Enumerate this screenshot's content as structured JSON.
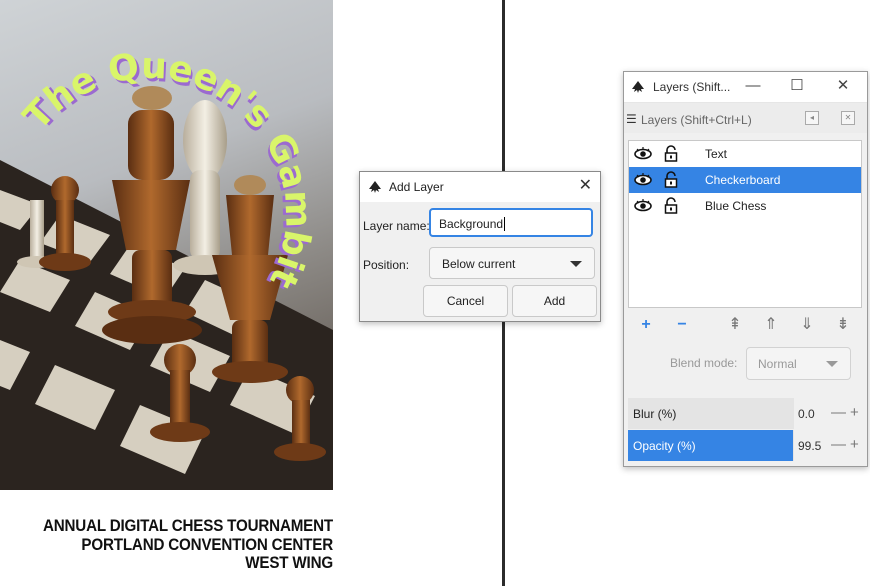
{
  "poster": {
    "title_arc": "The Queen's Gambit",
    "caption_lines": [
      "ANNUAL DIGITAL CHESS TOURNAMENT",
      "PORTLAND CONVENTION CENTER",
      "WEST WING"
    ],
    "title_color": "#d9f56a",
    "title_shadow": "#9b6ad0"
  },
  "add_layer_dialog": {
    "title": "Add Layer",
    "close_glyph": "✕",
    "layer_name_label": "Layer name:",
    "layer_name_value": "Background",
    "position_label": "Position:",
    "position_value": "Below current",
    "cancel_label": "Cancel",
    "add_label": "Add"
  },
  "layers_panel": {
    "window_title": "Layers (Shift...",
    "minimize_glyph": "—",
    "maximize_glyph": "☐",
    "close_glyph": "✕",
    "tab_label": "Layers (Shift+Ctrl+L)",
    "layers": [
      {
        "name": "Text",
        "selected": false
      },
      {
        "name": "Checkerboard",
        "selected": true
      },
      {
        "name": "Blue Chess",
        "selected": false
      }
    ],
    "tools": {
      "add": "+",
      "remove": "−",
      "raise_to_top": "⇞",
      "raise": "⇑",
      "lower": "⇓",
      "lower_to_bottom": "⇟"
    },
    "blend_mode_label": "Blend mode:",
    "blend_mode_value": "Normal",
    "blur": {
      "label": "Blur (%)",
      "value": "0.0",
      "fraction": 0.0
    },
    "opacity": {
      "label": "Opacity (%)",
      "value": "99.5",
      "fraction": 0.995
    },
    "accent_color": "#3584e4"
  }
}
